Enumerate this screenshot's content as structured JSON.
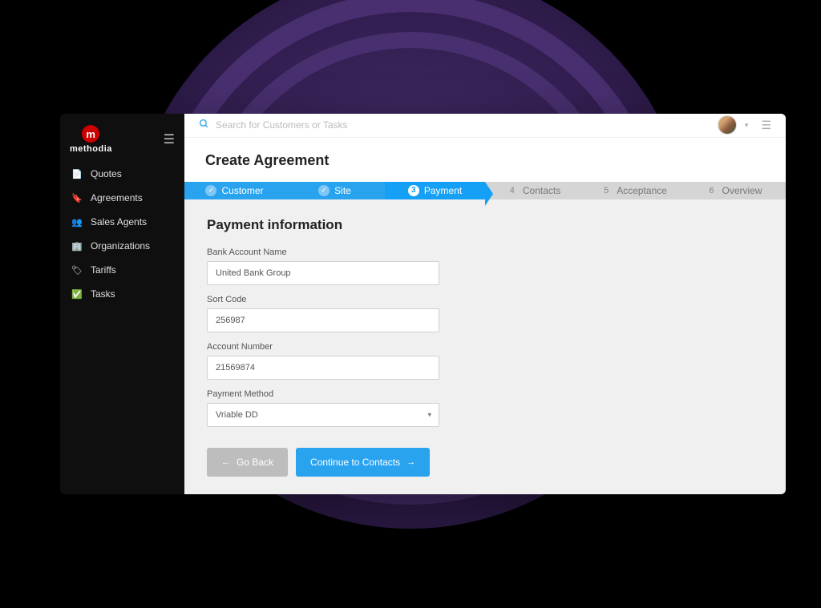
{
  "brand": {
    "name": "methodia",
    "mark": "m"
  },
  "search": {
    "placeholder": "Search for Customers or Tasks"
  },
  "sidebar": {
    "items": [
      {
        "label": "Quotes",
        "icon": "document-icon"
      },
      {
        "label": "Agreements",
        "icon": "bookmark-icon"
      },
      {
        "label": "Sales Agents",
        "icon": "users-icon"
      },
      {
        "label": "Organizations",
        "icon": "org-icon"
      },
      {
        "label": "Tariffs",
        "icon": "tag-icon"
      },
      {
        "label": "Tasks",
        "icon": "check-icon"
      }
    ]
  },
  "page": {
    "title": "Create Agreement",
    "section_title": "Payment information"
  },
  "stepper": {
    "steps": [
      {
        "label": "Customer",
        "state": "done"
      },
      {
        "label": "Site",
        "state": "done"
      },
      {
        "num": "3",
        "label": "Payment",
        "state": "active"
      },
      {
        "num": "4",
        "label": "Contacts",
        "state": "pending"
      },
      {
        "num": "5",
        "label": "Acceptance",
        "state": "pending"
      },
      {
        "num": "6",
        "label": "Overview",
        "state": "pending"
      }
    ]
  },
  "form": {
    "bank_name": {
      "label": "Bank Account Name",
      "value": "United Bank Group"
    },
    "sort_code": {
      "label": "Sort Code",
      "value": "256987"
    },
    "account_number": {
      "label": "Account Number",
      "value": "21569874"
    },
    "payment_method": {
      "label": "Payment Method",
      "value": "Vriable DD"
    }
  },
  "actions": {
    "back": "Go Back",
    "continue": "Continue to Contacts"
  }
}
